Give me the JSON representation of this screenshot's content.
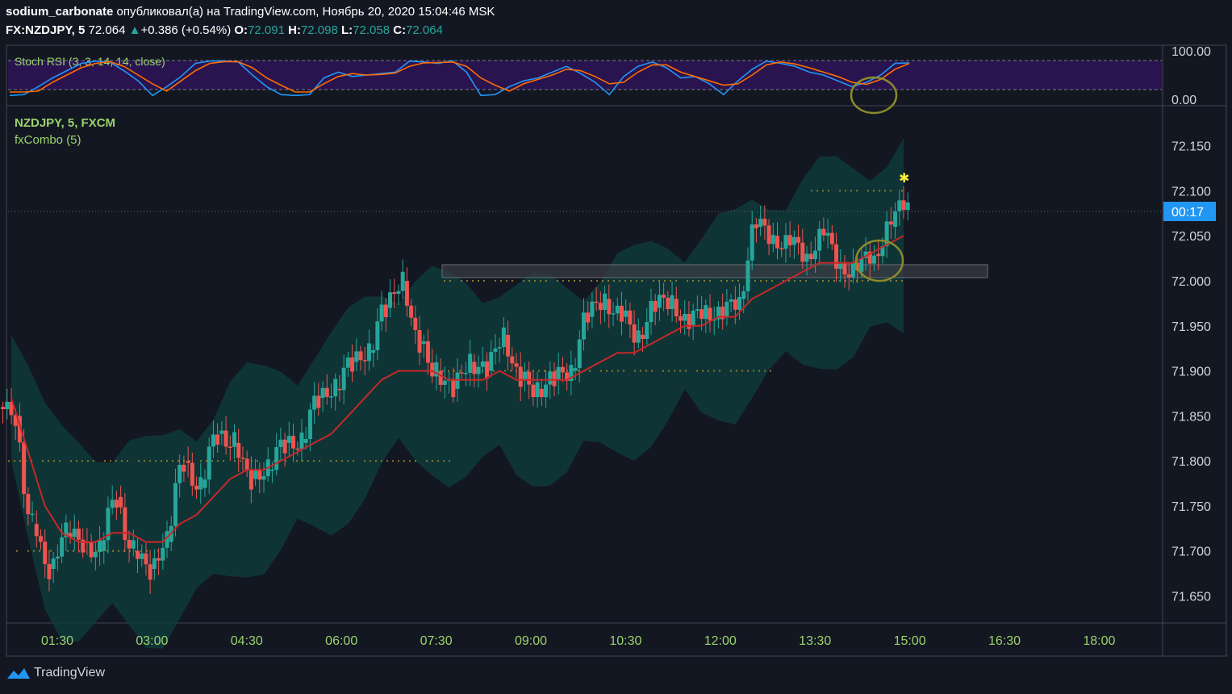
{
  "header": {
    "author": "sodium_carbonate",
    "published_text": "опубликовал(а) на TradingView.com, Ноябрь 20, 2020 15:04:46 MSK",
    "symbol": "FX:NZDJPY, 5",
    "last": "72.064",
    "arrow": "▲",
    "change": "+0.386 (+0.54%)",
    "o_label": "O:",
    "o_value": "72.091",
    "h_label": "H:",
    "h_value": "72.098",
    "l_label": "L:",
    "l_value": "72.058",
    "c_label": "C:",
    "c_value": "72.064"
  },
  "stoch_panel": {
    "title": "Stoch RSI (3, 3, 14, 14, close)",
    "axis_labels": [
      "100.00",
      "0.00"
    ]
  },
  "main_panel": {
    "legend_symbol": "NZDJPY, 5, FXCM",
    "legend_indicator": "fxCombo (5)",
    "countdown": "00:17"
  },
  "footer": {
    "brand": "TradingView"
  },
  "colors": {
    "background": "#131722",
    "up": "#26a69a",
    "down": "#ef5350",
    "stoch_k": "#2196f3",
    "stoch_d": "#ff6d00",
    "ma": "#c62828",
    "band": "#0f3a3a",
    "axis_text": "#d1d4dc",
    "time_text": "#9bd36b",
    "highlight": "#8b8b2b"
  },
  "chart_data": [
    {
      "type": "line",
      "title": "Stoch RSI (3, 3, 14, 14, close)",
      "ylim": [
        0,
        100
      ],
      "y_ticks": [
        100,
        0
      ],
      "series": [
        {
          "name": "K",
          "values": [
            2,
            5,
            10,
            40,
            65,
            90,
            98,
            95,
            65,
            30,
            2,
            10,
            45,
            90,
            98,
            99,
            95,
            50,
            10,
            5,
            2,
            5,
            40,
            60,
            45,
            50,
            55,
            60,
            98,
            95,
            90,
            99,
            60,
            2,
            5,
            10,
            30,
            40,
            60,
            80,
            55,
            25,
            5,
            45,
            80,
            95,
            75,
            40,
            45,
            20,
            5,
            30,
            70,
            98,
            90,
            80,
            60,
            50,
            30,
            10,
            25,
            50,
            90,
            92
          ]
        },
        {
          "name": "D",
          "values": [
            5,
            5,
            8,
            25,
            50,
            75,
            90,
            96,
            80,
            50,
            20,
            8,
            30,
            65,
            90,
            96,
            96,
            75,
            40,
            15,
            5,
            5,
            20,
            45,
            55,
            50,
            52,
            57,
            80,
            92,
            93,
            95,
            80,
            40,
            15,
            8,
            20,
            35,
            50,
            70,
            65,
            45,
            20,
            25,
            60,
            85,
            85,
            60,
            45,
            30,
            15,
            20,
            50,
            85,
            95,
            88,
            75,
            60,
            45,
            25,
            18,
            35,
            70,
            90
          ]
        }
      ]
    },
    {
      "type": "candlestick",
      "symbol": "NZDJPY, 5, FXCM",
      "ylim": [
        71.62,
        72.19
      ],
      "y_ticks": [
        "72.150",
        "72.100",
        "72.050",
        "72.000",
        "71.950",
        "71.900",
        "71.850",
        "71.800",
        "71.750",
        "71.700",
        "71.650"
      ],
      "x_ticks": [
        "01:30",
        "03:00",
        "04:30",
        "06:00",
        "07:30",
        "09:00",
        "10:30",
        "12:00",
        "13:30",
        "15:00",
        "16:30",
        "18:00"
      ],
      "series": [
        {
          "name": "close",
          "values": [
            71.85,
            71.73,
            71.68,
            71.72,
            71.71,
            71.7,
            71.76,
            71.7,
            71.68,
            71.71,
            71.8,
            71.77,
            71.83,
            71.82,
            71.78,
            71.79,
            71.82,
            71.82,
            71.87,
            71.88,
            71.91,
            71.92,
            71.97,
            72.0,
            71.93,
            71.9,
            71.88,
            71.91,
            71.9,
            71.94,
            71.89,
            71.88,
            71.89,
            71.9,
            71.96,
            71.98,
            71.96,
            71.94,
            71.97,
            71.98,
            71.95,
            71.97,
            71.96,
            71.98,
            72.06,
            72.05,
            72.04,
            72.03,
            72.05,
            72.02,
            72.01,
            72.03,
            72.06,
            72.09
          ]
        },
        {
          "name": "fxCombo MA",
          "values": [
            71.87,
            71.81,
            71.75,
            71.72,
            71.71,
            71.71,
            71.72,
            71.72,
            71.71,
            71.71,
            71.73,
            71.74,
            71.76,
            71.78,
            71.79,
            71.79,
            71.8,
            71.81,
            71.82,
            71.83,
            71.85,
            71.87,
            71.89,
            71.9,
            71.9,
            71.9,
            71.89,
            71.89,
            71.89,
            71.9,
            71.89,
            71.89,
            71.89,
            71.89,
            71.9,
            71.91,
            71.92,
            71.92,
            71.93,
            71.94,
            71.95,
            71.95,
            71.96,
            71.96,
            71.98,
            71.99,
            72.0,
            72.01,
            72.02,
            72.02,
            72.02,
            72.03,
            72.04,
            72.05
          ]
        }
      ],
      "current_price": 72.064,
      "resistance_zone": [
        71.992,
        72.007
      ]
    }
  ]
}
